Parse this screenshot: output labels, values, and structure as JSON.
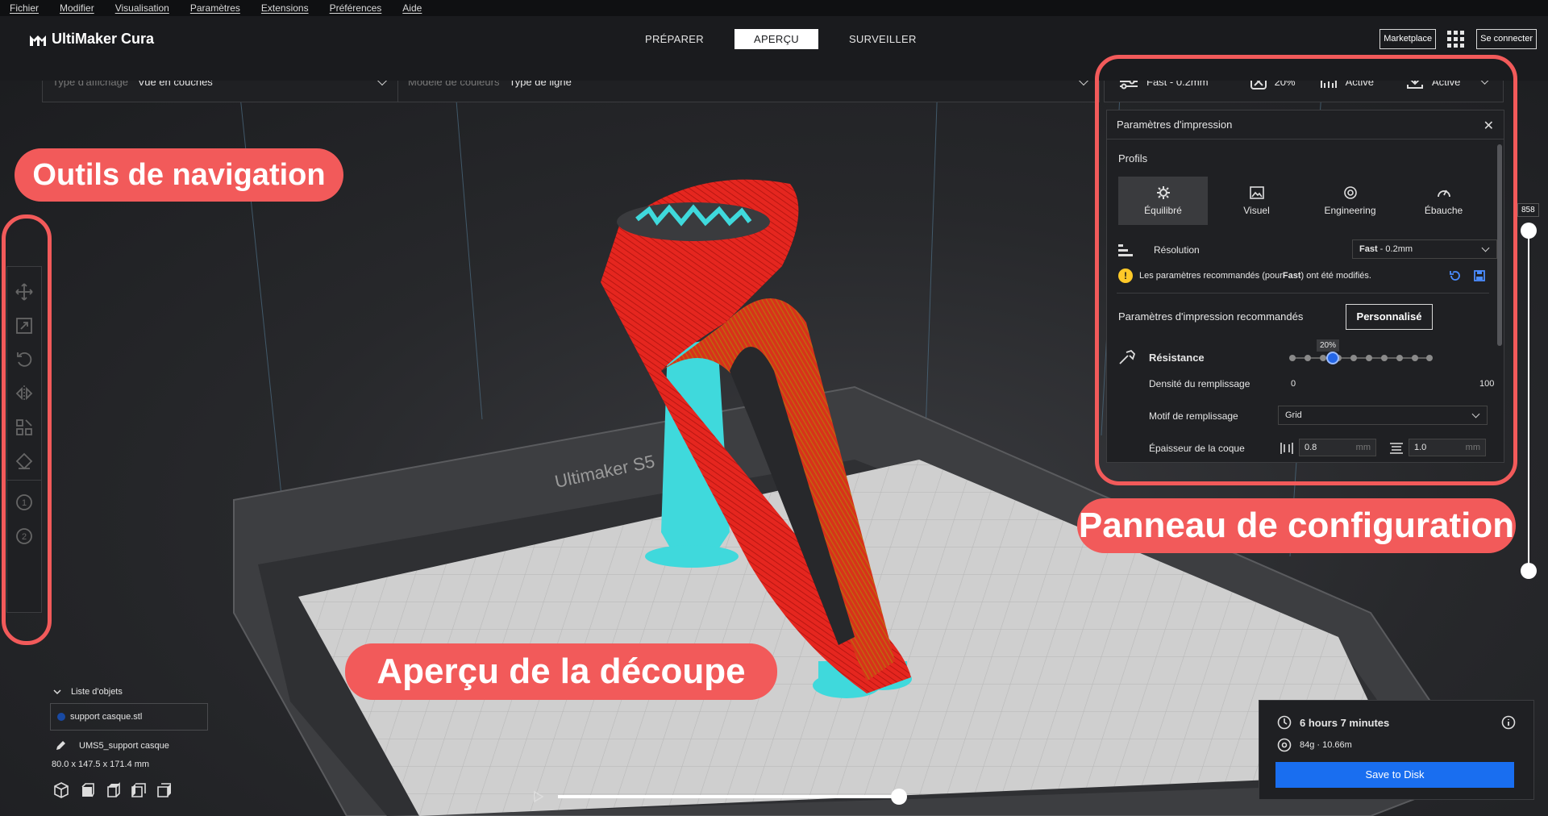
{
  "menu": [
    "Fichier",
    "Modifier",
    "Visualisation",
    "Paramètres",
    "Extensions",
    "Préférences",
    "Aide"
  ],
  "header": {
    "app_title": "UltiMaker Cura",
    "tabs": [
      "PRÉPARER",
      "APERÇU",
      "SURVEILLER"
    ],
    "active_tab": "APERÇU",
    "marketplace_label": "Marketplace",
    "signin_label": "Se connecter"
  },
  "viewbar": {
    "view_type_label": "Type d'affichage",
    "view_type_value": "Vue en couches",
    "color_model_label": "Modèle de couleurs",
    "color_model_value": "Type de ligne"
  },
  "summary": {
    "profile": "Fast - 0.2mm",
    "infill": "20%",
    "support": "Activé",
    "adhesion": "Activé"
  },
  "panel": {
    "title": "Paramètres d'impression",
    "profiles_title": "Profils",
    "profiles": [
      "Équilibré",
      "Visuel",
      "Engineering",
      "Ébauche"
    ],
    "active_profile": "Équilibré",
    "resolution_label": "Résolution",
    "resolution_value_bold": "Fast",
    "resolution_value_rest": " - 0.2mm",
    "warning_pre": "Les paramètres recommandés (pour ",
    "warning_bold": "Fast",
    "warning_post": ") ont été modifiés.",
    "recommended_title": "Paramètres d'impression recommandés",
    "custom_button": "Personnalisé",
    "strength_title": "Résistance",
    "infill_density_label": "Densité du remplissage",
    "infill_min": "0",
    "infill_max": "100",
    "infill_value": "20%",
    "infill_value_fraction": 0.2,
    "infill_pattern_label": "Motif de remplissage",
    "infill_pattern_value": "Grid",
    "shell_label": "Épaisseur de la coque",
    "shell_wall": "0.8",
    "shell_top": "1.0",
    "unit": "mm"
  },
  "layer_slider": {
    "top_value": "858"
  },
  "objects": {
    "header": "Liste d'objets",
    "item": "support casque.stl",
    "name": "UMS5_support casque",
    "dimensions": "80.0 x 147.5 x 171.4 mm"
  },
  "output": {
    "time": "6 hours 7 minutes",
    "material": "84g · 10.66m",
    "save_label": "Save to Disk"
  },
  "scene": {
    "printer_label": "Ultimaker S5"
  },
  "annotations": {
    "nav": "Outils de navigation",
    "config": "Panneau de configuration",
    "slice": "Aperçu de la découpe"
  },
  "colors": {
    "accent": "#196ef0",
    "callout": "#f25a5a",
    "model_red": "#e5261f",
    "support_cyan": "#3fd9dc"
  }
}
